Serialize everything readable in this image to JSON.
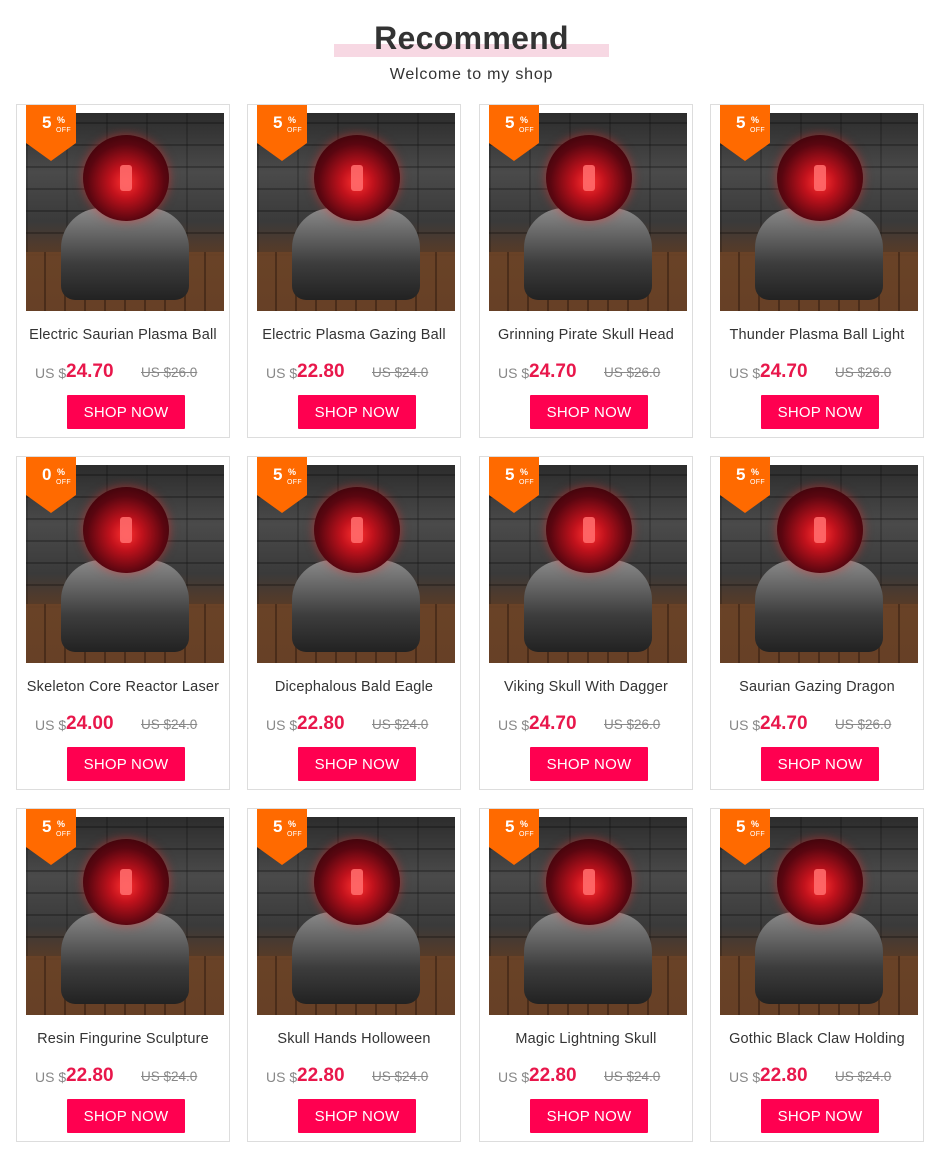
{
  "header": {
    "title": "Recommend",
    "subtitle": "Welcome to my shop"
  },
  "colors": {
    "accent": "#ff0050",
    "price": "#e8174b",
    "badge": "#ff6a00",
    "title_underline": "#f7d8e3"
  },
  "products": [
    {
      "name": "Electric Saurian Plasma Ball",
      "discount": "5",
      "pct_symbol": "%",
      "off_label": "OFF",
      "currency": "US $",
      "price": "24.70",
      "old_price": "US $26.0",
      "button": "SHOP NOW"
    },
    {
      "name": "Electric Plasma Gazing Ball",
      "discount": "5",
      "pct_symbol": "%",
      "off_label": "OFF",
      "currency": "US $",
      "price": "22.80",
      "old_price": "US $24.0",
      "button": "SHOP NOW"
    },
    {
      "name": "Grinning Pirate Skull Head",
      "discount": "5",
      "pct_symbol": "%",
      "off_label": "OFF",
      "currency": "US $",
      "price": "24.70",
      "old_price": "US $26.0",
      "button": "SHOP NOW"
    },
    {
      "name": "Thunder Plasma Ball Light",
      "discount": "5",
      "pct_symbol": "%",
      "off_label": "OFF",
      "currency": "US $",
      "price": "24.70",
      "old_price": "US $26.0",
      "button": "SHOP NOW"
    },
    {
      "name": "Skeleton Core Reactor Laser",
      "discount": "0",
      "pct_symbol": "%",
      "off_label": "OFF",
      "currency": "US $",
      "price": "24.00",
      "old_price": "US $24.0",
      "button": "SHOP NOW"
    },
    {
      "name": "Dicephalous Bald Eagle",
      "discount": "5",
      "pct_symbol": "%",
      "off_label": "OFF",
      "currency": "US $",
      "price": "22.80",
      "old_price": "US $24.0",
      "button": "SHOP NOW"
    },
    {
      "name": "Viking Skull With Dagger",
      "discount": "5",
      "pct_symbol": "%",
      "off_label": "OFF",
      "currency": "US $",
      "price": "24.70",
      "old_price": "US $26.0",
      "button": "SHOP NOW"
    },
    {
      "name": "Saurian Gazing Dragon",
      "discount": "5",
      "pct_symbol": "%",
      "off_label": "OFF",
      "currency": "US $",
      "price": "24.70",
      "old_price": "US $26.0",
      "button": "SHOP NOW"
    },
    {
      "name": "Resin Fingurine Sculpture",
      "discount": "5",
      "pct_symbol": "%",
      "off_label": "OFF",
      "currency": "US $",
      "price": "22.80",
      "old_price": "US $24.0",
      "button": "SHOP NOW"
    },
    {
      "name": "Skull Hands Holloween",
      "discount": "5",
      "pct_symbol": "%",
      "off_label": "OFF",
      "currency": "US $",
      "price": "22.80",
      "old_price": "US $24.0",
      "button": "SHOP NOW"
    },
    {
      "name": "Magic Lightning Skull",
      "discount": "5",
      "pct_symbol": "%",
      "off_label": "OFF",
      "currency": "US $",
      "price": "22.80",
      "old_price": "US $24.0",
      "button": "SHOP NOW"
    },
    {
      "name": "Gothic Black Claw Holding",
      "discount": "5",
      "pct_symbol": "%",
      "off_label": "OFF",
      "currency": "US $",
      "price": "22.80",
      "old_price": "US $24.0",
      "button": "SHOP NOW"
    }
  ]
}
